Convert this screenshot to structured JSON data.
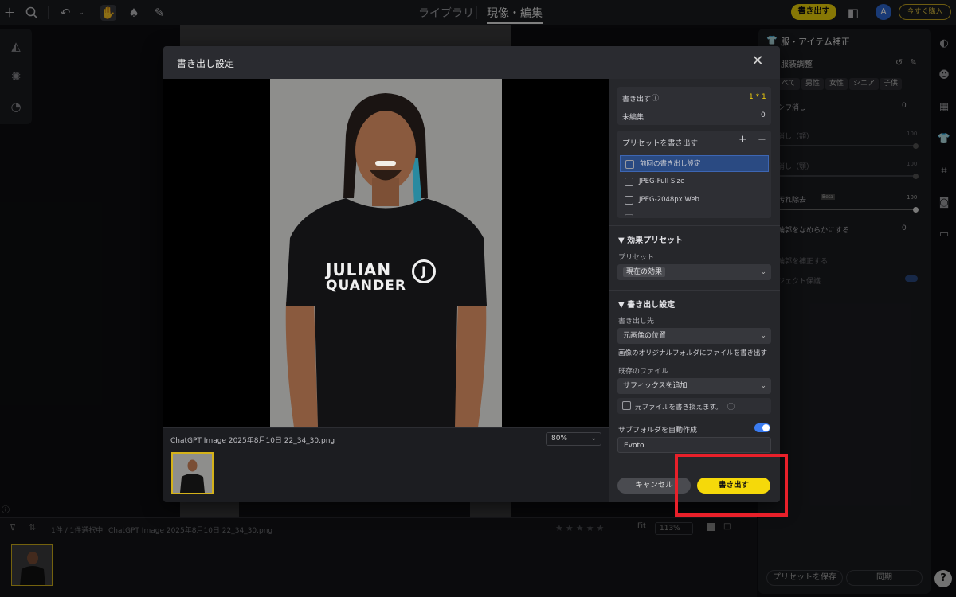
{
  "topbar": {
    "tab_library": "ライブラリ",
    "tab_develop": "現像・編集",
    "export_label": "書き出す",
    "avatar_initial": "A",
    "buy_label": "今すぐ購入"
  },
  "right_panel": {
    "title": "服・アイテム補正",
    "subtitle": "服装調整",
    "chips": [
      "べて",
      "男性",
      "女性",
      "シニア",
      "子供"
    ],
    "rows": [
      "シワ消し",
      "消し（額）",
      "消し（顎）",
      "汚れ除去",
      "輪郭をなめらかにする",
      "輪郭を補正する",
      "ジェクト保護"
    ],
    "row_values": [
      "0",
      "100",
      "100",
      "100",
      "0"
    ],
    "beta": "Beta",
    "save_preset": "プリセットを保存",
    "sync": "同期"
  },
  "bottom_bar": {
    "selection_info": "1件 / 1件選択中",
    "file_name": "ChatGPT Image 2025年8月10日 22_34_30.png",
    "fit": "Fit",
    "zoom": "113%",
    "stars": "★★★★★"
  },
  "modal": {
    "title": "書き出し設定",
    "close_icon": "close-icon",
    "file_name": "ChatGPT Image 2025年8月10日 22_34_30.png",
    "zoom": "80%",
    "shirt_text_1": "JULIAN",
    "shirt_text_2": "QUANDER",
    "shirt_logo": "J",
    "summary": {
      "export_label": "書き出す",
      "export_count": "1 * 1",
      "unedited_label": "未編集",
      "unedited_count": "0"
    },
    "presets": {
      "title": "プリセットを書き出す",
      "add": "+",
      "remove": "−",
      "items": [
        "前回の書き出し設定",
        "JPEG-Full Size",
        "JPEG-2048px Web"
      ],
      "selected_index": 0
    },
    "effect_presets": {
      "title": "効果プリセット",
      "preset_label": "プリセット",
      "preset_value": "現在の効果"
    },
    "export_settings": {
      "title": "書き出し設定",
      "destination_label": "書き出し先",
      "destination_value": "元画像の位置",
      "destination_note": "画像のオリジナルフォルダにファイルを書き出す",
      "existing_label": "既存のファイル",
      "existing_value": "サフィックスを追加",
      "overwrite_label": "元ファイルを書き換えます。",
      "subfolder_label": "サブフォルダを自動作成",
      "subfolder_enabled": true,
      "subfolder_name": "Evoto"
    },
    "cancel_label": "キャンセル",
    "export_label": "書き出す"
  },
  "colors": {
    "accent_yellow": "#f5d90a",
    "highlight_red": "#e8202a",
    "toggle_blue": "#3a7bf0",
    "selection_blue": "#2a4a82"
  }
}
